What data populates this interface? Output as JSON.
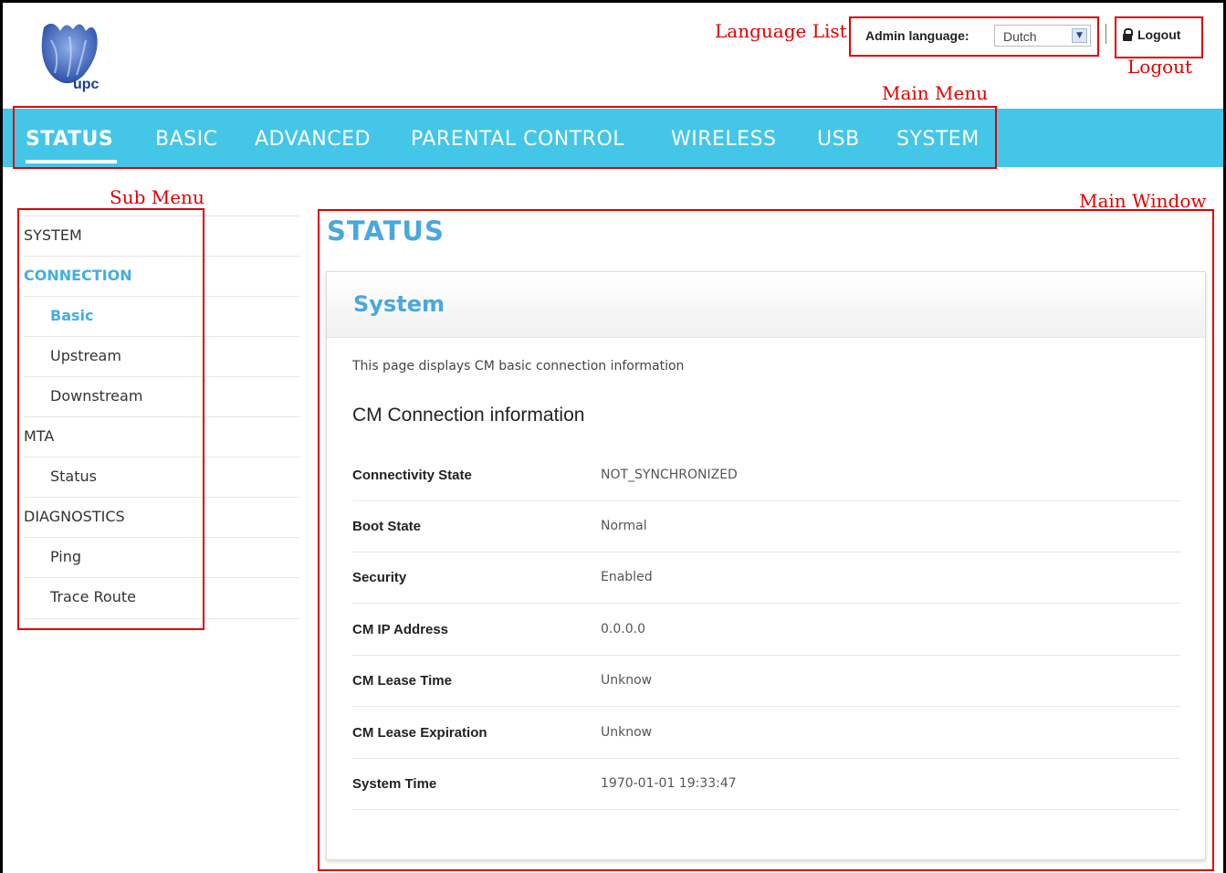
{
  "header": {
    "logo_text": "upc",
    "language_label": "Admin language:",
    "language_value": "Dutch",
    "logout_label": "Logout"
  },
  "annotations": {
    "language_list": "Language List",
    "logout": "Logout",
    "main_menu": "Main Menu",
    "sub_menu": "Sub Menu",
    "main_window": "Main Window"
  },
  "main_menu": {
    "items": [
      "STATUS",
      "BASIC",
      "ADVANCED",
      "PARENTAL CONTROL",
      "WIRELESS",
      "USB",
      "SYSTEM"
    ],
    "active": "STATUS"
  },
  "sub_menu": {
    "items": [
      {
        "label": "SYSTEM"
      },
      {
        "label": "CONNECTION"
      },
      {
        "label": "Basic"
      },
      {
        "label": "Upstream"
      },
      {
        "label": "Downstream"
      },
      {
        "label": "MTA"
      },
      {
        "label": "Status"
      },
      {
        "label": "DIAGNOSTICS"
      },
      {
        "label": "Ping"
      },
      {
        "label": "Trace Route"
      }
    ]
  },
  "main": {
    "page_title": "STATUS",
    "panel_title": "System",
    "description": "This page displays CM basic connection information",
    "section_title": "CM Connection information",
    "rows": [
      {
        "label": "Connectivity State",
        "value": "NOT_SYNCHRONIZED"
      },
      {
        "label": "Boot State",
        "value": "Normal"
      },
      {
        "label": "Security",
        "value": "Enabled"
      },
      {
        "label": "CM IP Address",
        "value": "0.0.0.0"
      },
      {
        "label": "CM Lease Time",
        "value": "Unknow"
      },
      {
        "label": "CM Lease Expiration",
        "value": "Unknow"
      },
      {
        "label": "System Time",
        "value": "1970-01-01 19:33:47"
      }
    ]
  },
  "colors": {
    "accent": "#43c6e8",
    "title_blue": "#4aa8dc",
    "annotation_red": "#e00000"
  }
}
